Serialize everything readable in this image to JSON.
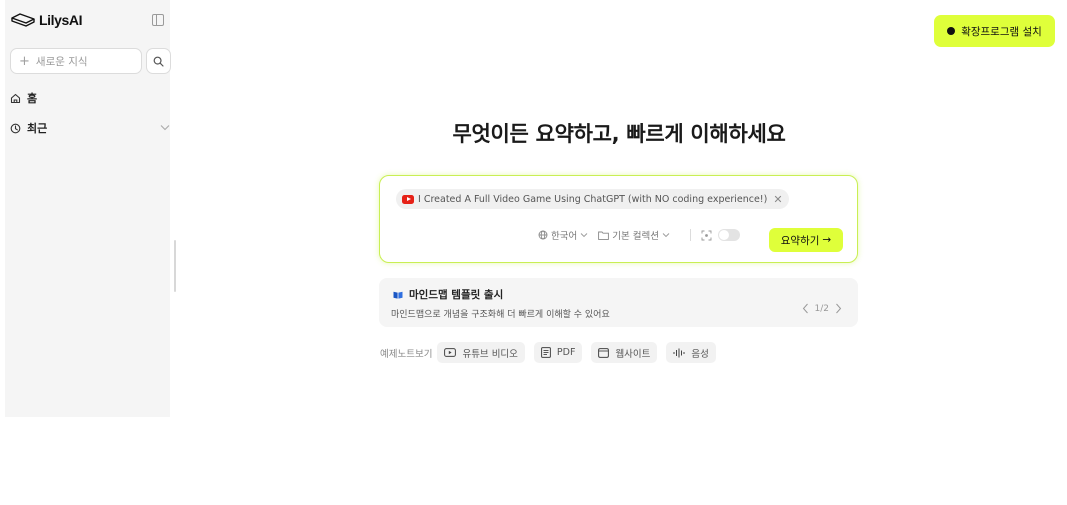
{
  "brand": {
    "name": "LilysAI"
  },
  "sidebar": {
    "new_note_placeholder": "새로운 지식",
    "items": [
      {
        "label": "홈",
        "icon": "home-icon"
      },
      {
        "label": "최근",
        "icon": "clock-icon"
      }
    ]
  },
  "header": {
    "extension_button_label": "확장프로그램 설치"
  },
  "main": {
    "headline": "무엇이든 요약하고, 빠르게 이해하세요",
    "input": {
      "video_chip_title": "I Created A Full Video Game Using ChatGPT (with NO coding experience!)",
      "language_label": "한국어",
      "collection_label": "기본 컬렉션",
      "summarize_label": "요약하기",
      "summarize_arrow": "→"
    },
    "notice": {
      "title": "마인드맵 템플릿 출시",
      "description": "마인드맵으로 개념을 구조화해 더 빠르게 이해할 수 있어요",
      "pager": "1/2"
    },
    "examples": {
      "label": "예제노트보기",
      "chips": [
        "유튜브 비디오",
        "PDF",
        "웹사이트",
        "음성"
      ]
    }
  },
  "colors": {
    "accent": "#dfff3a",
    "sidebar_bg": "#f5f5f5",
    "border_accent": "#c9ef53",
    "youtube_red": "#e62117"
  }
}
